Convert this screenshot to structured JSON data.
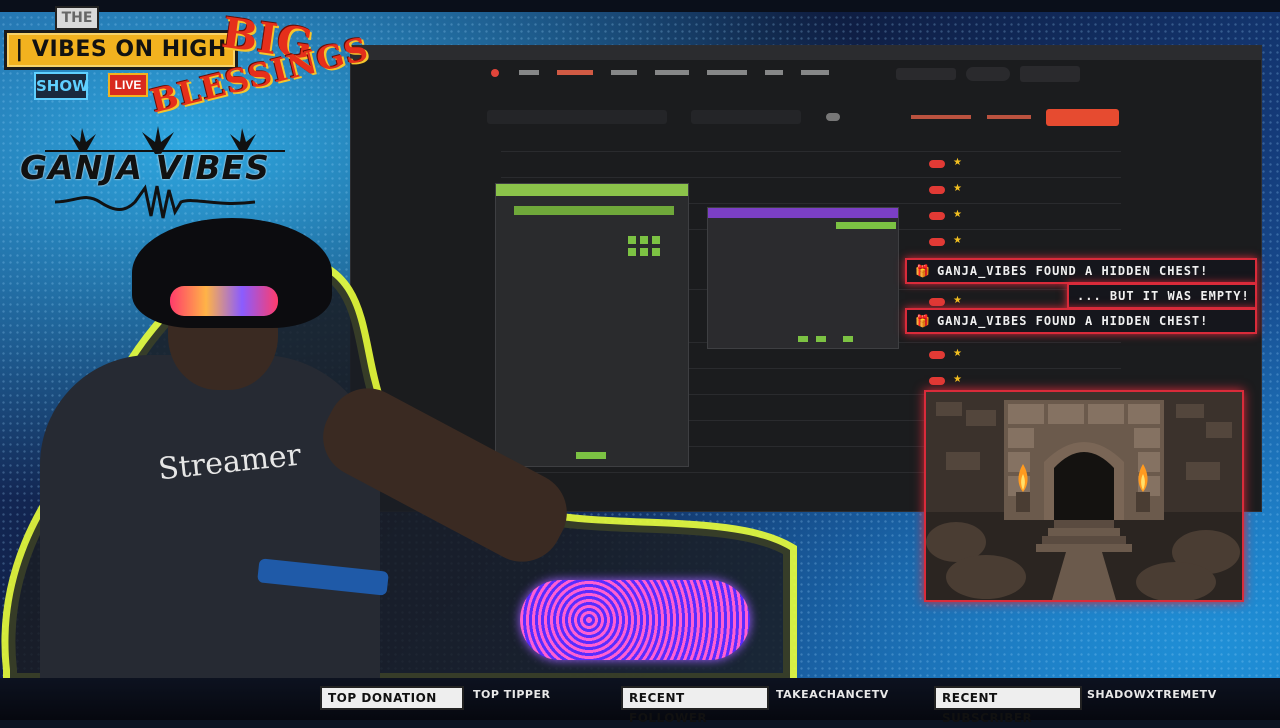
{
  "overlay": {
    "the": "THE",
    "vibes": "| VIBES ON HIGH |",
    "show": "SHOW",
    "live": "LIVE",
    "big": "BIG",
    "blessings": "BLESSINGS",
    "brand": "GANJA VIBES"
  },
  "webcam": {
    "shirt_text": "Streamer"
  },
  "alerts": [
    {
      "text": "GANJA_VIBES FOUND A HIDDEN CHEST!",
      "icon": "gift-icon"
    },
    {
      "text": "... BUT IT WAS EMPTY!"
    },
    {
      "text": "GANJA_VIBES FOUND A HIDDEN CHEST!",
      "icon": "gift-icon"
    }
  ],
  "ticker": {
    "top_donation_label": "TOP DONATION",
    "top_tipper_label": "TOP TIPPER",
    "recent_follower_label": "RECENT FOLLOWER",
    "recent_follower_value": "TAKEACHANCETV",
    "recent_subscriber_label": "RECENT SUBSCRIBER",
    "recent_subscriber_value": "SHADOWXTREMETV"
  },
  "colors": {
    "accent_red": "#d92b3a",
    "accent_yellow": "#f2b21f",
    "nav_accent": "#ff6a4d"
  }
}
